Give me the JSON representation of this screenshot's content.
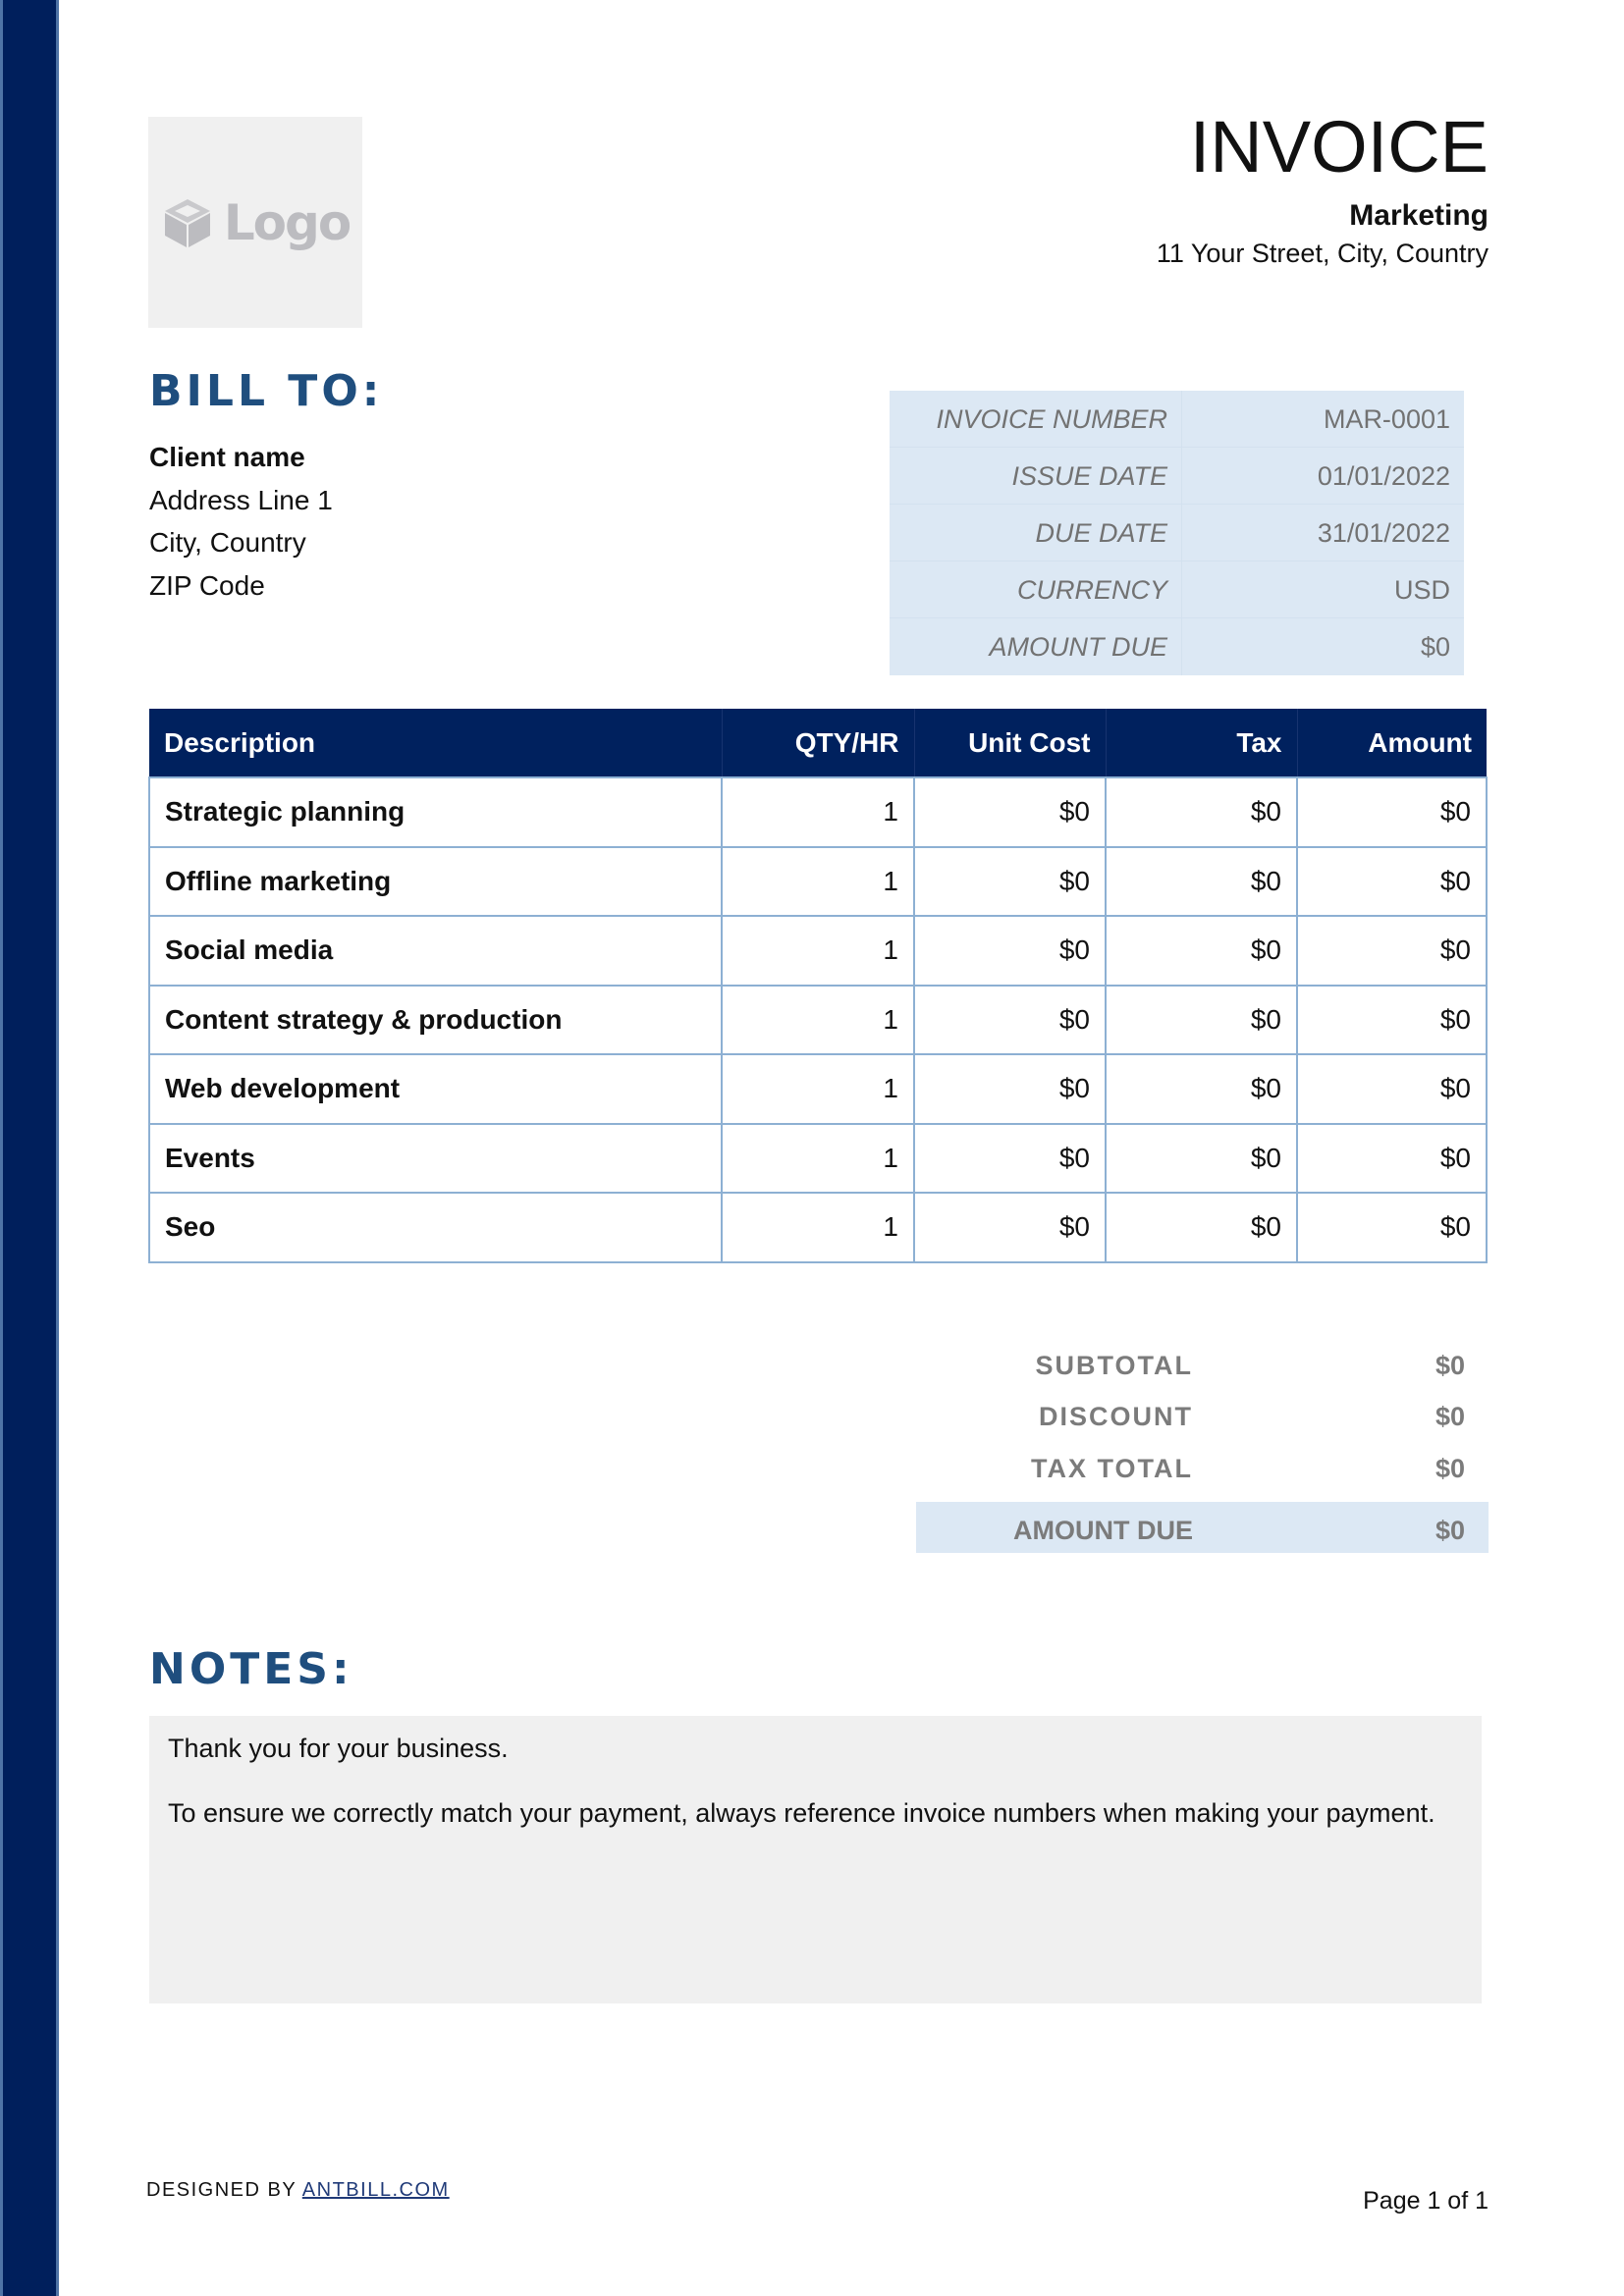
{
  "brand": {
    "accent": "#00215e",
    "heading_color": "#1f4e7e",
    "highlight_bg": "#dce8f4",
    "notes_bg": "#f0f0f0"
  },
  "logo": {
    "icon": "box-icon",
    "text": "Logo"
  },
  "header": {
    "title": "INVOICE",
    "company": "Marketing",
    "address": "11 Your Street, City, Country"
  },
  "bill_to": {
    "heading": "BILL TO:",
    "client_name": "Client name",
    "address_line": "Address Line 1",
    "city_country": "City, Country",
    "zip": "ZIP Code"
  },
  "invoice_info": [
    {
      "label": "INVOICE NUMBER",
      "value": "MAR-0001"
    },
    {
      "label": "ISSUE DATE",
      "value": "01/01/2022"
    },
    {
      "label": "DUE DATE",
      "value": "31/01/2022"
    },
    {
      "label": "CURRENCY",
      "value": "USD"
    },
    {
      "label": "AMOUNT DUE",
      "value": "$0"
    }
  ],
  "items_table": {
    "columns": [
      "Description",
      "QTY/HR",
      "Unit Cost",
      "Tax",
      "Amount"
    ],
    "rows": [
      {
        "description": "Strategic planning",
        "qty": "1",
        "unit_cost": "$0",
        "tax": "$0",
        "amount": "$0"
      },
      {
        "description": "Offline marketing",
        "qty": "1",
        "unit_cost": "$0",
        "tax": "$0",
        "amount": "$0"
      },
      {
        "description": "Social media",
        "qty": "1",
        "unit_cost": "$0",
        "tax": "$0",
        "amount": "$0"
      },
      {
        "description": "Content strategy & production",
        "qty": "1",
        "unit_cost": "$0",
        "tax": "$0",
        "amount": "$0"
      },
      {
        "description": "Web development",
        "qty": "1",
        "unit_cost": "$0",
        "tax": "$0",
        "amount": "$0"
      },
      {
        "description": "Events",
        "qty": "1",
        "unit_cost": "$0",
        "tax": "$0",
        "amount": "$0"
      },
      {
        "description": "Seo",
        "qty": "1",
        "unit_cost": "$0",
        "tax": "$0",
        "amount": "$0"
      }
    ]
  },
  "totals": [
    {
      "label": "SUBTOTAL",
      "value": "$0"
    },
    {
      "label": "DISCOUNT",
      "value": "$0"
    },
    {
      "label": "TAX TOTAL",
      "value": "$0"
    },
    {
      "label": "AMOUNT DUE",
      "value": "$0"
    }
  ],
  "notes": {
    "heading": "NOTES:",
    "line1": "Thank you for your business.",
    "line2": "To ensure we correctly match your payment, always reference invoice numbers when making your payment."
  },
  "footer": {
    "designed_by": "DESIGNED BY ",
    "link_text": "ANTBILL.COM",
    "page": "Page 1 of 1"
  }
}
